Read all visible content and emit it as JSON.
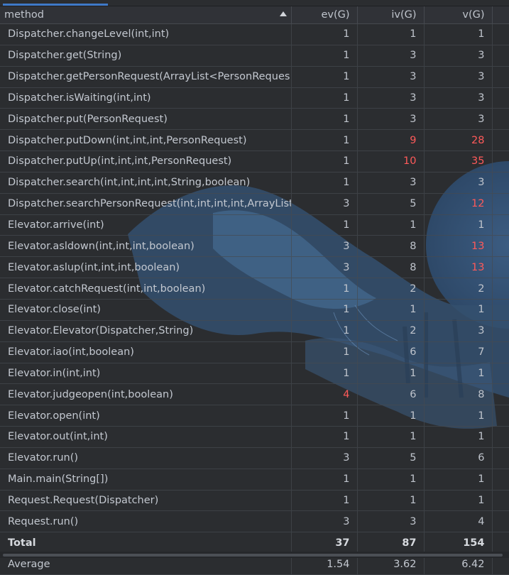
{
  "columns": {
    "method": "method",
    "ev": "ev(G)",
    "iv": "iv(G)",
    "v": "v(G)"
  },
  "sort": {
    "column": "method",
    "direction": "ascending"
  },
  "colors": {
    "background": "#2b2d30",
    "text": "#bfc4cc",
    "warning": "#ff5a5a",
    "tab_underline": "#3f79c8"
  },
  "rows": [
    {
      "method": "Dispatcher.changeLevel(int,int)",
      "ev": "1",
      "iv": "1",
      "v": "1",
      "ev_warn": false,
      "iv_warn": false,
      "v_warn": false
    },
    {
      "method": "Dispatcher.get(String)",
      "ev": "1",
      "iv": "3",
      "v": "3",
      "ev_warn": false,
      "iv_warn": false,
      "v_warn": false
    },
    {
      "method": "Dispatcher.getPersonRequest(ArrayList<PersonReques",
      "ev": "1",
      "iv": "3",
      "v": "3",
      "ev_warn": false,
      "iv_warn": false,
      "v_warn": false
    },
    {
      "method": "Dispatcher.isWaiting(int,int)",
      "ev": "1",
      "iv": "3",
      "v": "3",
      "ev_warn": false,
      "iv_warn": false,
      "v_warn": false
    },
    {
      "method": "Dispatcher.put(PersonRequest)",
      "ev": "1",
      "iv": "3",
      "v": "3",
      "ev_warn": false,
      "iv_warn": false,
      "v_warn": false
    },
    {
      "method": "Dispatcher.putDown(int,int,int,PersonRequest)",
      "ev": "1",
      "iv": "9",
      "v": "28",
      "ev_warn": false,
      "iv_warn": true,
      "v_warn": true
    },
    {
      "method": "Dispatcher.putUp(int,int,int,PersonRequest)",
      "ev": "1",
      "iv": "10",
      "v": "35",
      "ev_warn": false,
      "iv_warn": true,
      "v_warn": true
    },
    {
      "method": "Dispatcher.search(int,int,int,int,String,boolean)",
      "ev": "1",
      "iv": "3",
      "v": "3",
      "ev_warn": false,
      "iv_warn": false,
      "v_warn": false
    },
    {
      "method": "Dispatcher.searchPersonRequest(int,int,int,int,ArrayList",
      "ev": "3",
      "iv": "5",
      "v": "12",
      "ev_warn": false,
      "iv_warn": false,
      "v_warn": true
    },
    {
      "method": "Elevator.arrive(int)",
      "ev": "1",
      "iv": "1",
      "v": "1",
      "ev_warn": false,
      "iv_warn": false,
      "v_warn": false
    },
    {
      "method": "Elevator.asldown(int,int,int,boolean)",
      "ev": "3",
      "iv": "8",
      "v": "13",
      "ev_warn": false,
      "iv_warn": false,
      "v_warn": true
    },
    {
      "method": "Elevator.aslup(int,int,int,boolean)",
      "ev": "3",
      "iv": "8",
      "v": "13",
      "ev_warn": false,
      "iv_warn": false,
      "v_warn": true
    },
    {
      "method": "Elevator.catchRequest(int,int,boolean)",
      "ev": "1",
      "iv": "2",
      "v": "2",
      "ev_warn": false,
      "iv_warn": false,
      "v_warn": false
    },
    {
      "method": "Elevator.close(int)",
      "ev": "1",
      "iv": "1",
      "v": "1",
      "ev_warn": false,
      "iv_warn": false,
      "v_warn": false
    },
    {
      "method": "Elevator.Elevator(Dispatcher,String)",
      "ev": "1",
      "iv": "2",
      "v": "3",
      "ev_warn": false,
      "iv_warn": false,
      "v_warn": false
    },
    {
      "method": "Elevator.iao(int,boolean)",
      "ev": "1",
      "iv": "6",
      "v": "7",
      "ev_warn": false,
      "iv_warn": false,
      "v_warn": false
    },
    {
      "method": "Elevator.in(int,int)",
      "ev": "1",
      "iv": "1",
      "v": "1",
      "ev_warn": false,
      "iv_warn": false,
      "v_warn": false
    },
    {
      "method": "Elevator.judgeopen(int,boolean)",
      "ev": "4",
      "iv": "6",
      "v": "8",
      "ev_warn": true,
      "iv_warn": false,
      "v_warn": false
    },
    {
      "method": "Elevator.open(int)",
      "ev": "1",
      "iv": "1",
      "v": "1",
      "ev_warn": false,
      "iv_warn": false,
      "v_warn": false
    },
    {
      "method": "Elevator.out(int,int)",
      "ev": "1",
      "iv": "1",
      "v": "1",
      "ev_warn": false,
      "iv_warn": false,
      "v_warn": false
    },
    {
      "method": "Elevator.run()",
      "ev": "3",
      "iv": "5",
      "v": "6",
      "ev_warn": false,
      "iv_warn": false,
      "v_warn": false
    },
    {
      "method": "Main.main(String[])",
      "ev": "1",
      "iv": "1",
      "v": "1",
      "ev_warn": false,
      "iv_warn": false,
      "v_warn": false
    },
    {
      "method": "Request.Request(Dispatcher)",
      "ev": "1",
      "iv": "1",
      "v": "1",
      "ev_warn": false,
      "iv_warn": false,
      "v_warn": false
    },
    {
      "method": "Request.run()",
      "ev": "3",
      "iv": "3",
      "v": "4",
      "ev_warn": false,
      "iv_warn": false,
      "v_warn": false
    }
  ],
  "total": {
    "label": "Total",
    "ev": "37",
    "iv": "87",
    "v": "154"
  },
  "average": {
    "label": "Average",
    "ev": "1.54",
    "iv": "3.62",
    "v": "6.42"
  }
}
